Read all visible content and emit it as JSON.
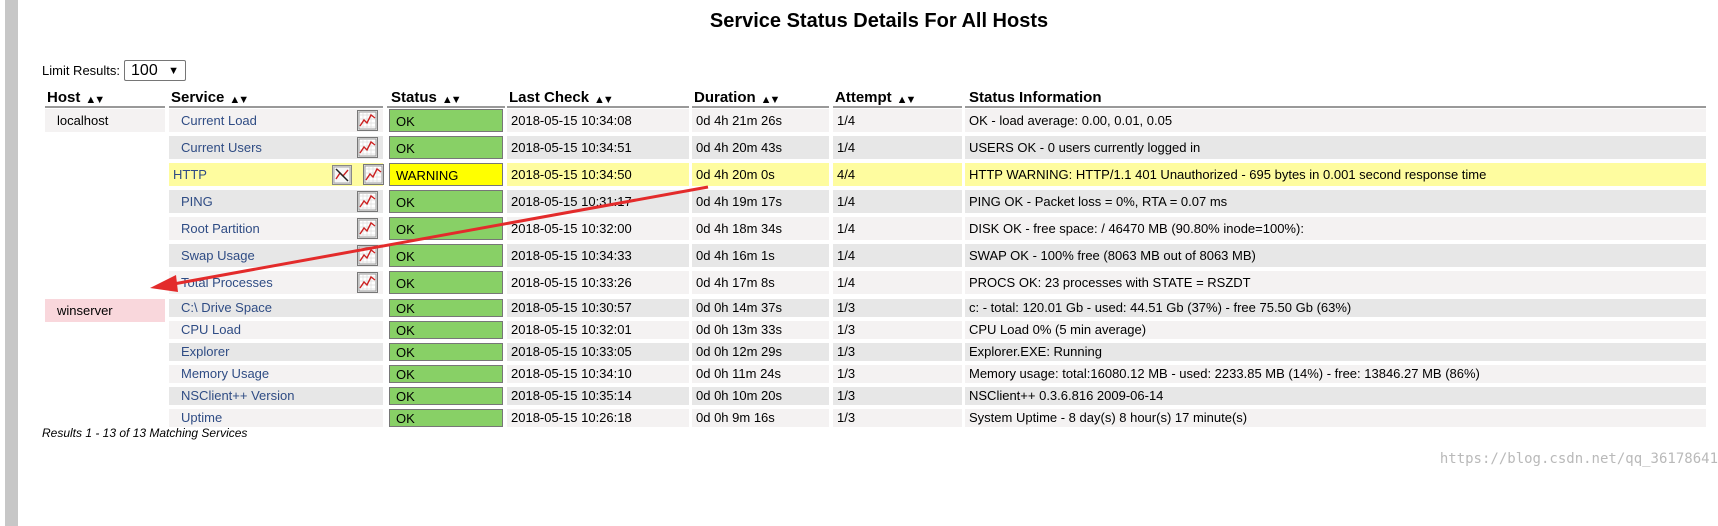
{
  "page": {
    "title": "Service Status Details For All Hosts",
    "limit_label": "Limit Results:",
    "limit_value": "100",
    "footer": "Results 1 - 13 of 13 Matching Services",
    "watermark": "https://blog.csdn.net/qq_36178641"
  },
  "columns": {
    "host": "Host",
    "service": "Service",
    "status": "Status",
    "last_check": "Last Check",
    "duration": "Duration",
    "attempt": "Attempt",
    "info": "Status Information"
  },
  "colors": {
    "ok": "#88d066",
    "warning": "#ffff00",
    "host_down": "#f9d7dc",
    "arrow": "#e32b2b",
    "link": "#2f4c84"
  },
  "hosts": [
    {
      "name": "localhost"
    },
    {
      "name": "winserver"
    }
  ],
  "rows": [
    {
      "service": "Current Load",
      "status": "OK",
      "last_check": "2018-05-15 10:34:08",
      "duration": "0d 4h 21m 26s",
      "attempt": "1/4",
      "info": "OK - load average: 0.00, 0.01, 0.05"
    },
    {
      "service": "Current Users",
      "status": "OK",
      "last_check": "2018-05-15 10:34:51",
      "duration": "0d 4h 20m 43s",
      "attempt": "1/4",
      "info": "USERS OK - 0 users currently logged in"
    },
    {
      "service": "HTTP",
      "status": "WARNING",
      "last_check": "2018-05-15 10:34:50",
      "duration": "0d 4h 20m 0s",
      "attempt": "4/4",
      "info": "HTTP WARNING: HTTP/1.1 401 Unauthorized - 695 bytes in 0.001 second response time"
    },
    {
      "service": "PING",
      "status": "OK",
      "last_check": "2018-05-15 10:31:17",
      "duration": "0d 4h 19m 17s",
      "attempt": "1/4",
      "info": "PING OK - Packet loss = 0%, RTA = 0.07 ms"
    },
    {
      "service": "Root Partition",
      "status": "OK",
      "last_check": "2018-05-15 10:32:00",
      "duration": "0d 4h 18m 34s",
      "attempt": "1/4",
      "info": "DISK OK - free space: / 46470 MB (90.80% inode=100%):"
    },
    {
      "service": "Swap Usage",
      "status": "OK",
      "last_check": "2018-05-15 10:34:33",
      "duration": "0d 4h 16m 1s",
      "attempt": "1/4",
      "info": "SWAP OK - 100% free (8063 MB out of 8063 MB)"
    },
    {
      "service": "Total Processes",
      "status": "OK",
      "last_check": "2018-05-15 10:33:26",
      "duration": "0d 4h 17m 8s",
      "attempt": "1/4",
      "info": "PROCS OK: 23 processes with STATE = RSZDT"
    },
    {
      "service": "C:\\ Drive Space",
      "status": "OK",
      "last_check": "2018-05-15 10:30:57",
      "duration": "0d 0h 14m 37s",
      "attempt": "1/3",
      "info": "c: - total: 120.01 Gb - used: 44.51 Gb (37%) - free 75.50 Gb (63%)"
    },
    {
      "service": "CPU Load",
      "status": "OK",
      "last_check": "2018-05-15 10:32:01",
      "duration": "0d 0h 13m 33s",
      "attempt": "1/3",
      "info": "CPU Load 0% (5 min average)"
    },
    {
      "service": "Explorer",
      "status": "OK",
      "last_check": "2018-05-15 10:33:05",
      "duration": "0d 0h 12m 29s",
      "attempt": "1/3",
      "info": "Explorer.EXE: Running"
    },
    {
      "service": "Memory Usage",
      "status": "OK",
      "last_check": "2018-05-15 10:34:10",
      "duration": "0d 0h 11m 24s",
      "attempt": "1/3",
      "info": "Memory usage: total:16080.12 MB - used: 2233.85 MB (14%) - free: 13846.27 MB (86%)"
    },
    {
      "service": "NSClient++ Version",
      "status": "OK",
      "last_check": "2018-05-15 10:35:14",
      "duration": "0d 0h 10m 20s",
      "attempt": "1/3",
      "info": "NSClient++ 0.3.6.816 2009-06-14"
    },
    {
      "service": "Uptime",
      "status": "OK",
      "last_check": "2018-05-15 10:26:18",
      "duration": "0d 0h 9m 16s",
      "attempt": "1/3",
      "info": "System Uptime - 8 day(s) 8 hour(s) 17 minute(s)"
    }
  ]
}
